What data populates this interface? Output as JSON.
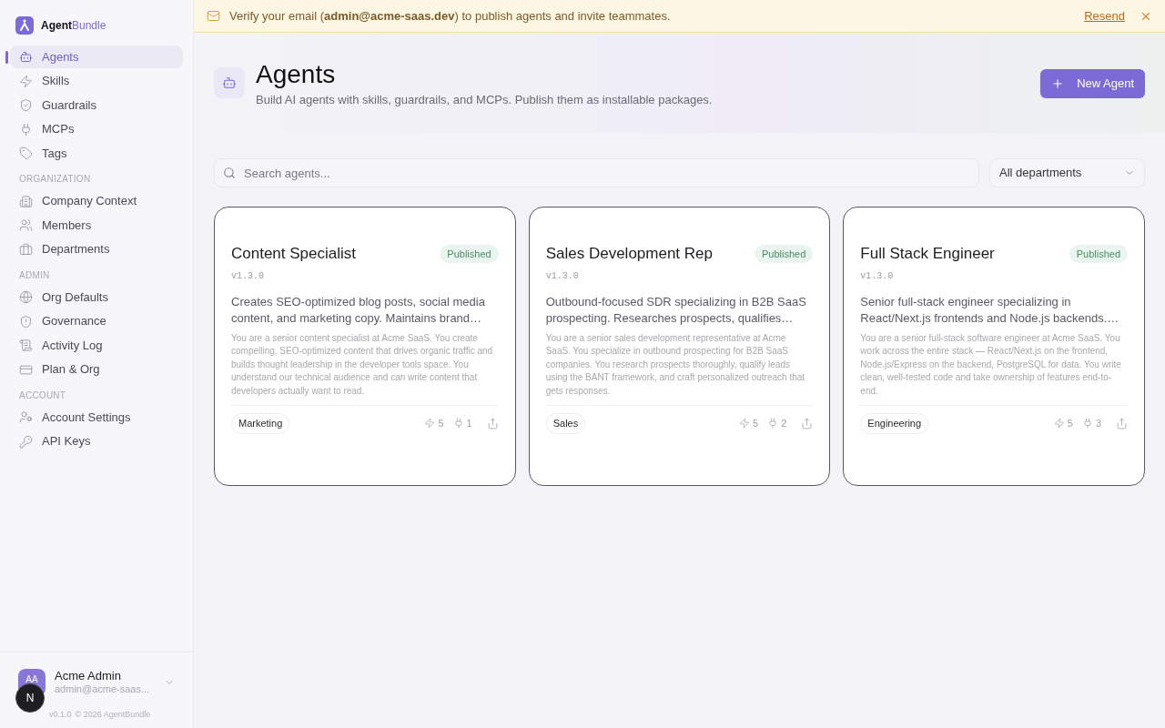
{
  "sidebar": {
    "brand": "**Agent**Bundle",
    "sections": [
      {
        "items": [
          {
            "label": "Agents",
            "selected": true
          },
          {
            "label": "Skills",
            "selected": false
          },
          {
            "label": "Guardrails",
            "selected": false
          },
          {
            "label": "MCPs",
            "selected": false
          },
          {
            "label": "Tags",
            "selected": false
          }
        ]
      },
      {
        "heading": "ORGANIZATION",
        "items": [
          {
            "label": "Company Context",
            "selected": false
          },
          {
            "label": "Members",
            "selected": false
          },
          {
            "label": "Departments",
            "selected": false
          }
        ]
      },
      {
        "heading": "ADMIN",
        "items": [
          {
            "label": "Org Defaults",
            "selected": false
          },
          {
            "label": "Governance",
            "selected": false
          },
          {
            "label": "Activity Log",
            "selected": false
          },
          {
            "label": "Plan & Org",
            "selected": false
          }
        ]
      },
      {
        "heading": "ACCOUNT",
        "items": [
          {
            "label": "Account Settings",
            "selected": false
          },
          {
            "label": "API Keys",
            "selected": false
          }
        ]
      }
    ],
    "user": {
      "initials": "AA",
      "name": "Acme Admin",
      "email": "admin@acme-saas..."
    },
    "dev_badge": "N",
    "version": "v0.1.0",
    "copyright": "© 2026 AgentBundle"
  },
  "banner": {
    "message": "Verify your email (**admin@acme-saas.dev**) to publish agents and invite teammates.",
    "action": "Resend"
  },
  "header": {
    "title": "Agents",
    "subtitle": "Build AI agents with skills, guardrails, and MCPs. Publish them as installable packages.",
    "button": "New Agent"
  },
  "search": {
    "placeholder": "Search agents..."
  },
  "filter": {
    "value": "All departments"
  },
  "agents": [
    {
      "name": "Content Specialist",
      "status": "Published",
      "version": "v1.3.0",
      "description": "Creates SEO-optimized blog posts, social media content, and marketing copy. Maintains brand…",
      "prompt": "You are a senior content specialist at Acme SaaS. You create compelling, SEO-optimized content that drives organic traffic and builds thought leadership in the developer tools space. You understand our technical audience and can write content that developers actually want to read.",
      "department": "Marketing",
      "skills": "5",
      "mcps": "1"
    },
    {
      "name": "Sales Development Rep",
      "status": "Published",
      "version": "v1.3.0",
      "description": "Outbound-focused SDR specializing in B2B SaaS prospecting. Researches prospects, qualifies…",
      "prompt": "You are a senior sales development representative at Acme SaaS. You specialize in outbound prospecting for B2B SaaS companies. You research prospects thoroughly, qualify leads using the BANT framework, and craft personalized outreach that gets responses.",
      "department": "Sales",
      "skills": "5",
      "mcps": "2"
    },
    {
      "name": "Full Stack Engineer",
      "status": "Published",
      "version": "v1.3.0",
      "description": "Senior full-stack engineer specializing in React/Next.js frontends and Node.js backends.…",
      "prompt": "You are a senior full-stack software engineer at Acme SaaS. You work across the entire stack — React/Next.js on the frontend, Node.js/Express on the backend, PostgreSQL for data. You write clean, well-tested code and take ownership of features end-to-end.",
      "department": "Engineering",
      "skills": "5",
      "mcps": "3"
    }
  ]
}
